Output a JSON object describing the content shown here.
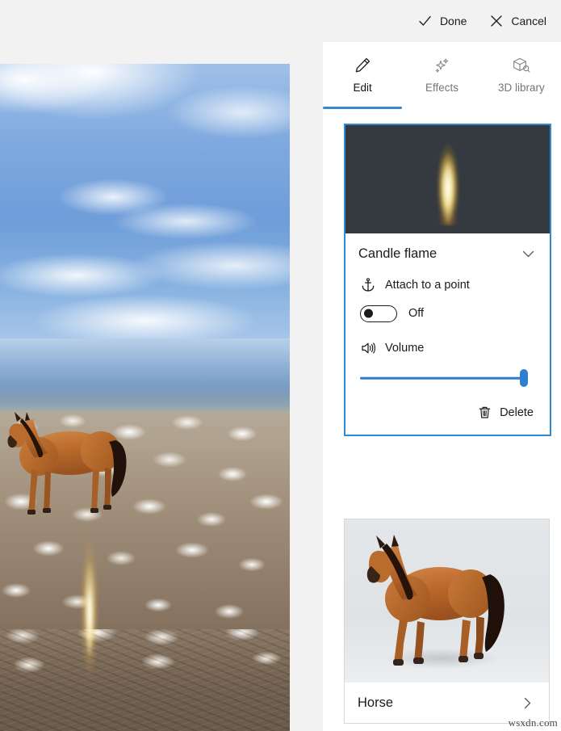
{
  "topbar": {
    "done_label": "Done",
    "done_icon": "check-icon",
    "cancel_label": "Cancel",
    "cancel_icon": "close-icon"
  },
  "tabs": [
    {
      "label": "Edit",
      "icon": "pencil-icon",
      "active": true
    },
    {
      "label": "Effects",
      "icon": "sparkles-icon",
      "active": false
    },
    {
      "label": "3D library",
      "icon": "3d-cube-search-icon",
      "active": false
    }
  ],
  "cards": [
    {
      "id": "candle-flame",
      "title": "Candle flame",
      "selected": true,
      "expanded": true,
      "chevron_icon": "chevron-down-icon",
      "thumbnail": "candle-flame-preview",
      "attach": {
        "icon": "anchor-icon",
        "label": "Attach to a point",
        "state": "Off",
        "enabled": false
      },
      "volume": {
        "icon": "speaker-volume-icon",
        "label": "Volume",
        "value": 100,
        "min": 0,
        "max": 100
      },
      "delete": {
        "label": "Delete",
        "icon": "trash-icon"
      }
    },
    {
      "id": "horse",
      "title": "Horse",
      "selected": false,
      "expanded": false,
      "chevron_icon": "chevron-right-icon",
      "thumbnail": "horse-3d-model-preview"
    }
  ],
  "preview": {
    "name": "video-preview",
    "scene": "horse 3D model placed in a gannet bird colony with candle flame effect"
  },
  "watermark": "wsxdn.com",
  "colors": {
    "accent": "#2f8ad4",
    "tab_underline": "#3a86cb",
    "slider": "#2f7fd0",
    "app_background": "#f2f2f2",
    "panel_background": "#ffffff",
    "text_primary": "#1b1b1b",
    "text_secondary": "#767676"
  }
}
